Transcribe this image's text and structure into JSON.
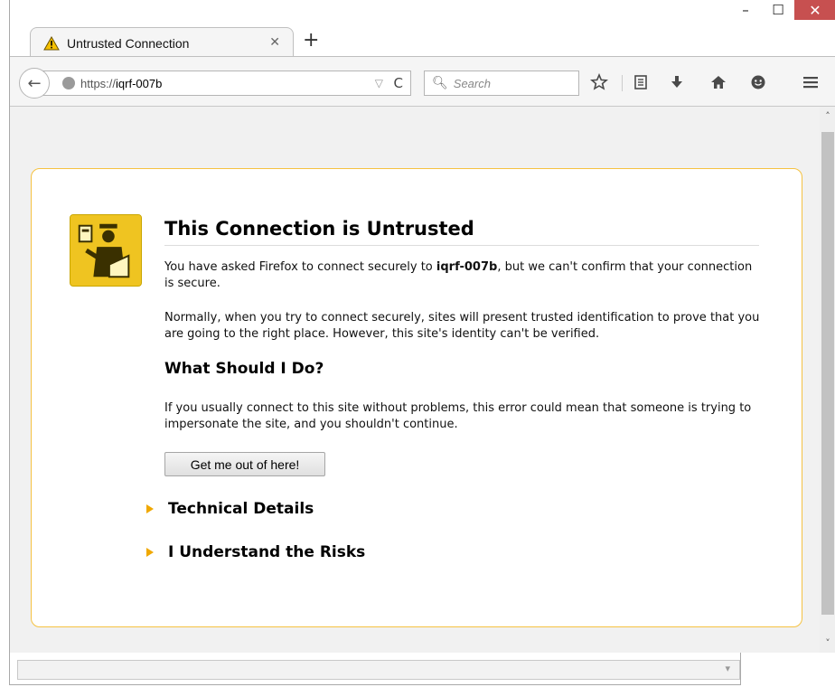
{
  "window": {
    "minimize": "–",
    "maximize": "☐",
    "close": "✕"
  },
  "tab": {
    "title": "Untrusted Connection",
    "close": "✕",
    "new_tab": "+"
  },
  "navbar": {
    "back": "←",
    "url_scheme": "https://",
    "url_host": "iqrf-007b",
    "url_dropdown": "▽",
    "reload": "C",
    "search_placeholder": "Search",
    "icons": [
      "bookmark-star-icon",
      "reading-list-icon",
      "downloads-icon",
      "home-icon",
      "hello-icon",
      "menu-icon"
    ]
  },
  "error": {
    "title": "This Connection is Untrusted",
    "p1_before": "You have asked Firefox to connect securely to ",
    "p1_host": "iqrf-007b",
    "p1_after": ", but we can't confirm that your connection is secure.",
    "p2": "Normally, when you try to connect securely, sites will present trusted identification to prove that you are going to the right place. However, this site's identity can't be verified.",
    "what_title": "What Should I Do?",
    "p3": "If you usually connect to this site without problems, this error could mean that someone is trying to impersonate the site, and you shouldn't continue.",
    "button": "Get me out of here!",
    "technical": "Technical Details",
    "risks": "I Understand the Risks"
  },
  "colors": {
    "box_border": "#f5c242",
    "accent_triangle": "#f0a800",
    "close_button": "#c75050"
  }
}
